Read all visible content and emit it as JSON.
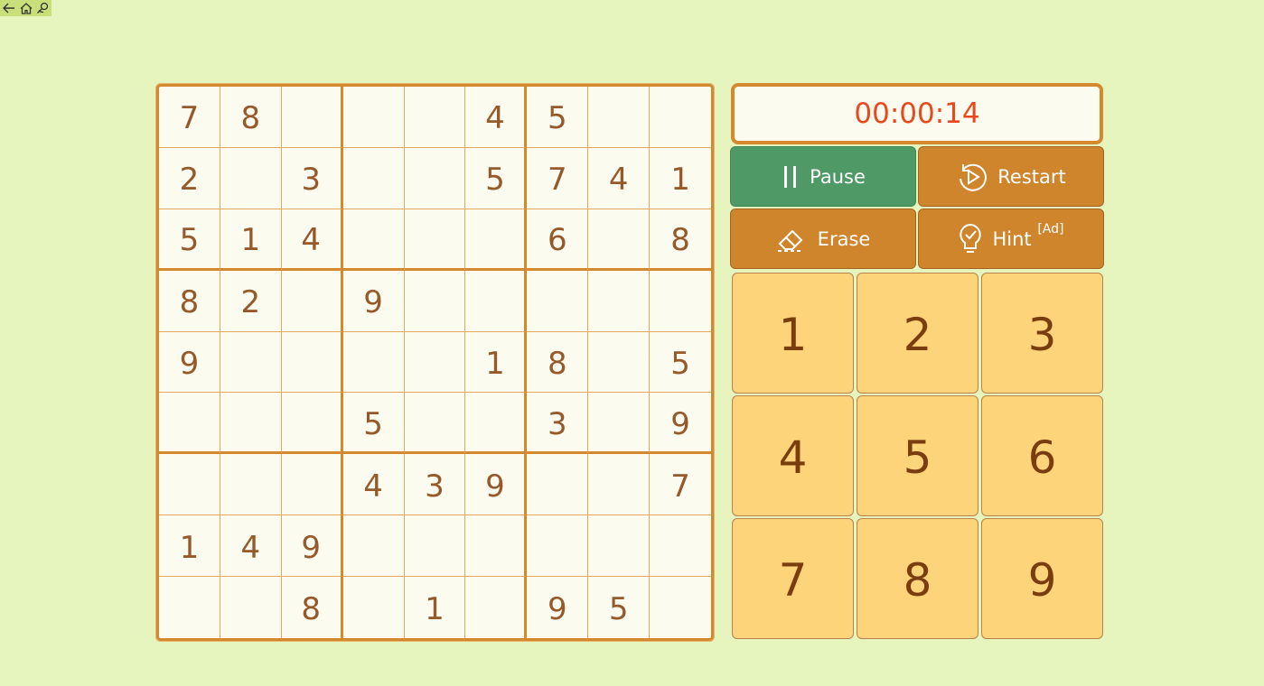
{
  "topbar": {
    "icons": [
      "back-arrow-icon",
      "home-icon",
      "user-search-icon"
    ]
  },
  "board": {
    "rows": [
      [
        "7",
        "8",
        "",
        "",
        "",
        "4",
        "5",
        "",
        ""
      ],
      [
        "2",
        "",
        "3",
        "",
        "",
        "5",
        "7",
        "4",
        "1"
      ],
      [
        "5",
        "1",
        "4",
        "",
        "",
        "",
        "6",
        "",
        "8"
      ],
      [
        "8",
        "2",
        "",
        "9",
        "",
        "",
        "",
        "",
        ""
      ],
      [
        "9",
        "",
        "",
        "",
        "",
        "1",
        "8",
        "",
        "5"
      ],
      [
        "",
        "",
        "",
        "5",
        "",
        "",
        "3",
        "",
        "9"
      ],
      [
        "",
        "",
        "",
        "4",
        "3",
        "9",
        "",
        "",
        "7"
      ],
      [
        "1",
        "4",
        "9",
        "",
        "",
        "",
        "",
        "",
        ""
      ],
      [
        "",
        "",
        "8",
        "",
        "1",
        "",
        "9",
        "5",
        ""
      ]
    ]
  },
  "timer": {
    "value": "00:00:14"
  },
  "controls": {
    "pause_label": "Pause",
    "restart_label": "Restart",
    "erase_label": "Erase",
    "hint_label": "Hint",
    "hint_badge": "[Ad]"
  },
  "numpad": [
    "1",
    "2",
    "3",
    "4",
    "5",
    "6",
    "7",
    "8",
    "9"
  ],
  "colors": {
    "background": "#e6f4bd",
    "accent": "#d4892e",
    "pause": "#4e9965",
    "timer_text": "#e8481b",
    "digit": "#96592a",
    "numpad": "#fed47b"
  }
}
